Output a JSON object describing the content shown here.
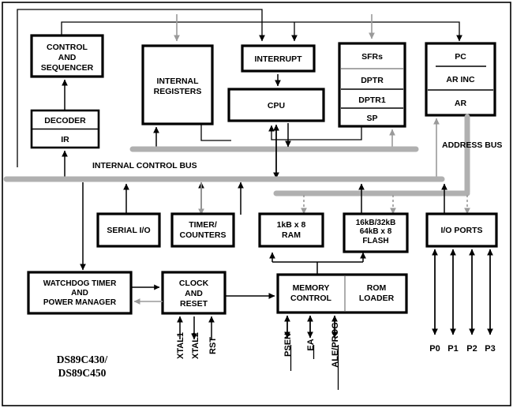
{
  "diagram": {
    "title": "DS89C430/DS89C450 Block Diagram",
    "part_label_line1": "DS89C430/",
    "part_label_line2": "DS89C450",
    "colors": {
      "bus": "#b0b0b0",
      "line": "#000000",
      "gray_line": "#9a9a9a",
      "background": "#ffffff"
    },
    "blocks": {
      "control_sequencer": {
        "line1": "CONTROL",
        "line2": "AND",
        "line3": "SEQUENCER"
      },
      "decoder": {
        "label": "DECODER"
      },
      "ir": {
        "label": "IR"
      },
      "internal_registers": {
        "line1": "INTERNAL",
        "line2": "REGISTERS"
      },
      "interrupt": {
        "label": "INTERRUPT"
      },
      "cpu": {
        "label": "CPU"
      },
      "sfr_stack": {
        "rows": [
          "SFRs",
          "DPTR",
          "DPTR1",
          "SP"
        ]
      },
      "pc_stack": {
        "rows": [
          "PC",
          "AR INC",
          "AR"
        ]
      },
      "serial_io": {
        "label": "SERIAL I/O"
      },
      "timer_counters": {
        "line1": "TIMER/",
        "line2": "COUNTERS"
      },
      "ram": {
        "line1": "1kB x 8",
        "line2": "RAM"
      },
      "flash": {
        "line1": "16kB/32kB",
        "line2": "64kB x 8",
        "line3": "FLASH"
      },
      "io_ports": {
        "label": "I/O PORTS"
      },
      "watchdog": {
        "line1": "WATCHDOG TIMER",
        "line2": "AND",
        "line3": "POWER MANAGER"
      },
      "clock_reset": {
        "line1": "CLOCK",
        "line2": "AND",
        "line3": "RESET"
      },
      "memory_control": {
        "line1": "MEMORY",
        "line2": "CONTROL"
      },
      "rom_loader": {
        "line1": "ROM",
        "line2": "LOADER"
      }
    },
    "buses": {
      "internal_control_bus": "INTERNAL CONTROL BUS",
      "address_bus": "ADDRESS BUS"
    },
    "pins": {
      "clock": [
        {
          "name": "XTAL1",
          "overbar": false
        },
        {
          "name": "XTAL2",
          "overbar": false
        },
        {
          "name": "RST",
          "overbar": false
        }
      ],
      "memory": [
        {
          "name": "PSEN",
          "overbar": true
        },
        {
          "name": "EA",
          "overbar": true
        },
        {
          "name": "ALE/PROG",
          "overbar": true
        }
      ],
      "ports": [
        {
          "name": "P0"
        },
        {
          "name": "P1"
        },
        {
          "name": "P2"
        },
        {
          "name": "P3"
        }
      ]
    }
  }
}
